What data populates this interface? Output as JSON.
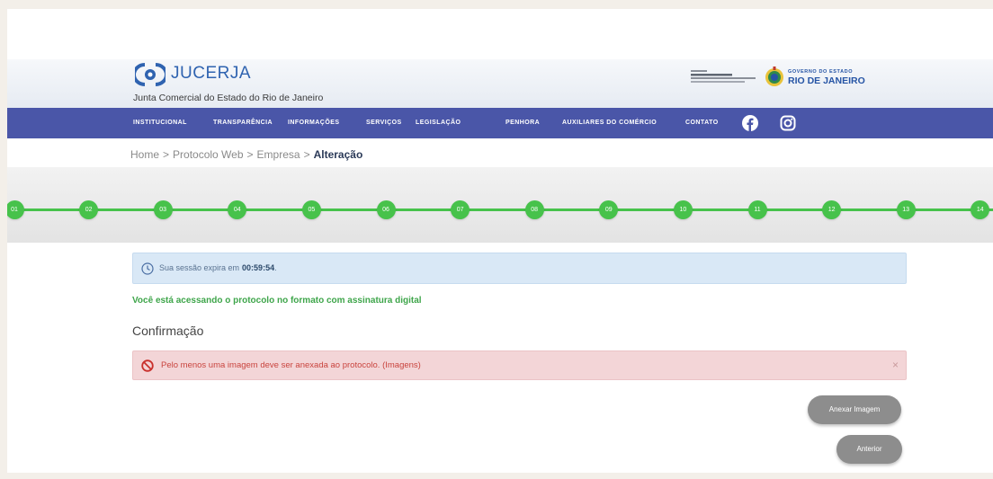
{
  "header": {
    "logo_text": "JUCERJA",
    "logo_subtitle": "Junta Comercial do Estado do Rio de Janeiro",
    "gov_logo": {
      "line1": "GOVERNO DO ESTADO",
      "line2": "RIO DE JANEIRO"
    }
  },
  "nav": {
    "items": [
      "INSTITUCIONAL",
      "TRANSPARÊNCIA",
      "INFORMAÇÕES",
      "SERVIÇOS",
      "LEGISLAÇÃO",
      "PENHORA",
      "AUXILIARES DO COMÉRCIO",
      "CONTATO"
    ],
    "social_icons": [
      "facebook-icon",
      "instagram-icon"
    ]
  },
  "breadcrumb": {
    "items": [
      "Home",
      "Protocolo Web",
      "Empresa",
      "Alteração"
    ],
    "separator": ">"
  },
  "stepper": {
    "steps": [
      "01",
      "02",
      "03",
      "04",
      "05",
      "06",
      "07",
      "08",
      "09",
      "10",
      "11",
      "12",
      "13",
      "14"
    ]
  },
  "session": {
    "icon": "clock-icon",
    "text": "Sua sessão expira em",
    "time": "00:59:54",
    "suffix": "."
  },
  "notice": "Você está acessando o protocolo no formato com assinatura digital",
  "section_title": "Confirmação",
  "error": {
    "icon": "ban-icon",
    "message": "Pelo menos uma imagem deve ser anexada ao protocolo. (Imagens)",
    "close": "×"
  },
  "buttons": {
    "attach": "Anexar Imagem",
    "previous": "Anterior"
  },
  "colors": {
    "brand_blue": "#2f63b0",
    "nav_bg": "#4a56a8",
    "step_green": "#47c24b",
    "notice_green": "#3ea54a",
    "info_bg": "#d9e8f6",
    "error_bg": "#f3d5d7",
    "error_text": "#c9443e",
    "button_bg": "#8d8d8d"
  }
}
